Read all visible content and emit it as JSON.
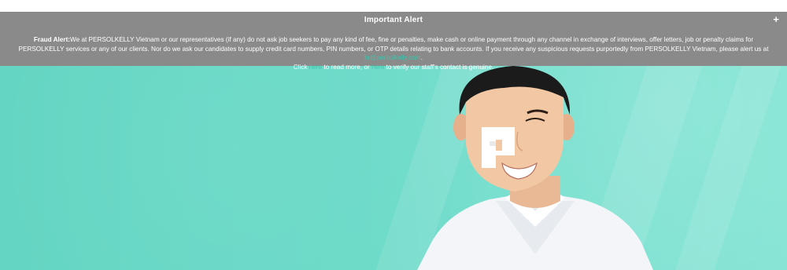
{
  "alert": {
    "title": "Important Alert",
    "toggle": "+",
    "label": "Fraud Alert:",
    "text1": "We at PERSOLKELLY Vietnam or our representatives (if any) do not ask job seekers to pay any kind of fee, fine or penalties, make cash or online payment through any channel in exchange of interviews, offer letters, job or penalty claims for PERSOLKELLY services or any of our clients. Nor do we ask our candidates to supply credit card numbers, PIN numbers, or OTP details relating to bank accounts. If you receive any suspicious requests purportedly from PERSOLKELLY Vietnam, please alert us at ",
    "email_link": "hr@persolkelly.com",
    "text2": ".",
    "text3": "Click ",
    "here_link_1": "here",
    "text4": " to read more, or ",
    "here_link_2": "here",
    "text5": " to verify our staff's contact is genuine."
  },
  "colors": {
    "alert_bg": "#8a8a8a",
    "hero_teal": "#6ad9c7",
    "link": "#3fc3ad"
  },
  "icons": {
    "logo": "persolkelly-logo-icon",
    "toggle": "plus-icon"
  }
}
